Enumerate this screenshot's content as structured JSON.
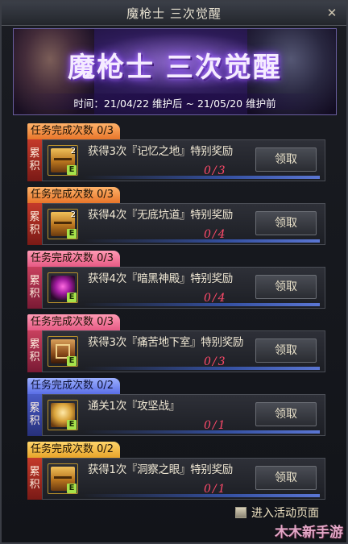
{
  "window": {
    "title": "魔枪士 三次觉醒",
    "close_icon": "close-icon"
  },
  "banner": {
    "title": "魔枪士 三次觉醒",
    "period": "时间：21/04/22 维护后 ~ 21/05/20 维护前"
  },
  "side_label": [
    "累",
    "积"
  ],
  "claim_label": "领取",
  "tasks": [
    {
      "tag": "任务完成次数 0/3",
      "icon": "chest",
      "icon_count": "2",
      "desc": "获得3次『记忆之地』特别奖励",
      "progress": "0/3"
    },
    {
      "tag": "任务完成次数 0/3",
      "icon": "chest",
      "icon_count": "2",
      "desc": "获得4次『无底坑道』特别奖励",
      "progress": "0/4"
    },
    {
      "tag": "任务完成次数 0/3",
      "icon": "orb",
      "icon_count": "",
      "desc": "获得4次『暗黑神殿』特别奖励",
      "progress": "0/4"
    },
    {
      "tag": "任务完成次数 0/3",
      "icon": "crate",
      "icon_count": "",
      "desc": "获得3次『痛苦地下室』特别奖励",
      "progress": "0/3"
    },
    {
      "tag": "任务完成次数 0/2",
      "icon": "shield",
      "icon_count": "",
      "desc": "通关1次『攻坚战』",
      "progress": "0/1"
    },
    {
      "tag": "任务完成次数 0/2",
      "icon": "chest",
      "icon_count": "",
      "desc": "获得1次『洞察之眼』特别奖励",
      "progress": "0/1"
    }
  ],
  "footer": {
    "link_label": "进入活动页面"
  },
  "watermark": "木木新手游"
}
